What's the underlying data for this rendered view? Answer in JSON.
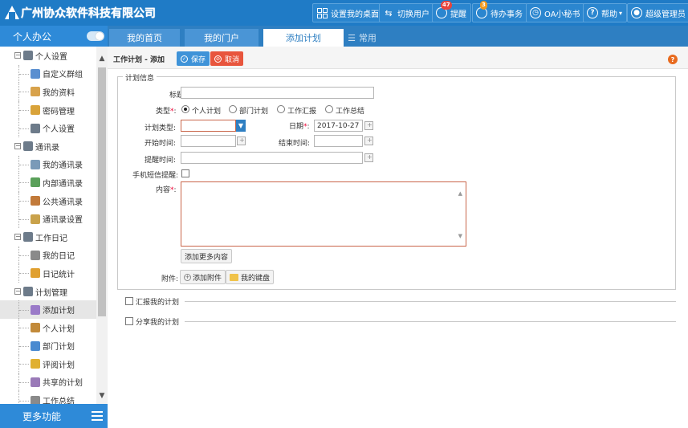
{
  "app": {
    "logo_text": "广州协众软件科技有限公司"
  },
  "topbar": {
    "buttons": [
      {
        "label": "设置我的桌面",
        "icon": "grid-icon"
      },
      {
        "label": "切换用户",
        "icon": "switch-user-icon"
      },
      {
        "label": "提醒",
        "icon": "bell-icon",
        "badge": "47"
      },
      {
        "label": "待办事务",
        "icon": "todo-icon",
        "badge": "3"
      },
      {
        "label": "OA小秘书",
        "icon": "clock-icon"
      },
      {
        "label": "帮助",
        "icon": "help-icon"
      },
      {
        "label": "超级管理员",
        "icon": "user-icon"
      }
    ]
  },
  "sidebar": {
    "title": "个人办公",
    "footer": "更多功能",
    "tree": [
      {
        "level": 1,
        "label": "个人设置",
        "color": "#6d7b8a"
      },
      {
        "level": 2,
        "label": "自定义群组",
        "color": "#5a8fd0"
      },
      {
        "level": 2,
        "label": "我的资料",
        "color": "#d8a24b"
      },
      {
        "level": 2,
        "label": "密码管理",
        "color": "#d9a33a"
      },
      {
        "level": 2,
        "label": "个人设置",
        "color": "#6d7b8a"
      },
      {
        "level": 1,
        "label": "通讯录",
        "color": "#6d7b8a"
      },
      {
        "level": 2,
        "label": "我的通讯录",
        "color": "#7a9ab8"
      },
      {
        "level": 2,
        "label": "内部通讯录",
        "color": "#5aa05a"
      },
      {
        "level": 2,
        "label": "公共通讯录",
        "color": "#c27a3a"
      },
      {
        "level": 2,
        "label": "通讯录设置",
        "color": "#c9a24b"
      },
      {
        "level": 1,
        "label": "工作日记",
        "color": "#6d7b8a"
      },
      {
        "level": 2,
        "label": "我的日记",
        "color": "#8a8a8a"
      },
      {
        "level": 2,
        "label": "日记统计",
        "color": "#e0a030"
      },
      {
        "level": 1,
        "label": "计划管理",
        "color": "#6d7b8a"
      },
      {
        "level": 2,
        "label": "添加计划",
        "color": "#9a7ac8",
        "selected": true
      },
      {
        "level": 2,
        "label": "个人计划",
        "color": "#c28a3a"
      },
      {
        "level": 2,
        "label": "部门计划",
        "color": "#4a8ad0"
      },
      {
        "level": 2,
        "label": "评阅计划",
        "color": "#e0b030"
      },
      {
        "level": 2,
        "label": "共享的计划",
        "color": "#9a7ab8"
      },
      {
        "level": 2,
        "label": "工作总结",
        "color": "#8a8a8a"
      }
    ]
  },
  "tabs": [
    {
      "label": "我的首页",
      "state": "normal"
    },
    {
      "label": "我的门户",
      "state": "normal"
    },
    {
      "label": "添加计划",
      "state": "active"
    },
    {
      "label": "常用",
      "state": "plain"
    }
  ],
  "toolbar": {
    "title": "工作计划 - 添加",
    "save_label": "保存",
    "cancel_label": "取消"
  },
  "form": {
    "legend": "计划信息",
    "title_label": "标题",
    "title_value": "",
    "type_label": "类型",
    "type_options": [
      "个人计划",
      "部门计划",
      "工作汇报",
      "工作总结"
    ],
    "type_selected": "个人计划",
    "plan_type_label": "计划类型:",
    "plan_type_value": "",
    "date_label": "日期",
    "date_value": "2017-10-27",
    "start_label": "开始时间:",
    "start_value": "",
    "end_label": "结束时间:",
    "end_value": "",
    "remind_label": "提醒时间:",
    "remind_value": "",
    "sms_label": "手机短信提醒:",
    "content_label": "内容",
    "content_value": "",
    "add_more_label": "添加更多内容",
    "attach_label": "附件:",
    "add_attach_label": "添加附件",
    "my_disk_label": "我的键盘"
  },
  "sections": [
    {
      "label": "汇报我的计划"
    },
    {
      "label": "分享我的计划"
    }
  ],
  "colors": {
    "topbar": "#1f7bc6",
    "accent": "#2e8ad8",
    "save": "#3f93d8",
    "cancel": "#e8553d",
    "required": "#ee0033"
  }
}
